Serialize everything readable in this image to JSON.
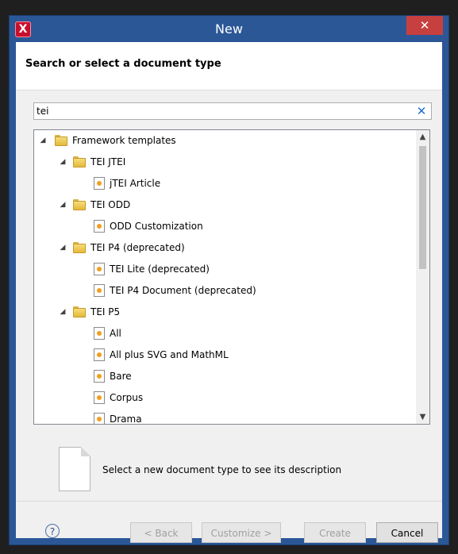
{
  "window": {
    "title": "New",
    "app_icon": "X",
    "close": "✕"
  },
  "header": {
    "title": "Search or select a document type"
  },
  "search": {
    "value": "tei",
    "clear": "✕"
  },
  "tree": {
    "items": [
      {
        "label": "Framework templates",
        "type": "folder",
        "expanded": true
      },
      {
        "label": "TEI JTEI",
        "type": "folder",
        "expanded": true
      },
      {
        "label": "jTEI Article",
        "type": "file"
      },
      {
        "label": "TEI ODD",
        "type": "folder",
        "expanded": true
      },
      {
        "label": "ODD Customization",
        "type": "file"
      },
      {
        "label": "TEI P4 (deprecated)",
        "type": "folder",
        "expanded": true
      },
      {
        "label": "TEI Lite (deprecated)",
        "type": "file"
      },
      {
        "label": "TEI P4 Document (deprecated)",
        "type": "file"
      },
      {
        "label": "TEI P5",
        "type": "folder",
        "expanded": true
      },
      {
        "label": "All",
        "type": "file"
      },
      {
        "label": "All plus SVG and MathML",
        "type": "file"
      },
      {
        "label": "Bare",
        "type": "file"
      },
      {
        "label": "Corpus",
        "type": "file"
      },
      {
        "label": "Drama",
        "type": "file"
      }
    ],
    "expander_glyph": "◢"
  },
  "description": {
    "text": "Select a new document type to see its description"
  },
  "footer": {
    "help": "?",
    "back": "< Back",
    "customize": "Customize >",
    "create": "Create",
    "cancel": "Cancel"
  },
  "colors": {
    "titlebar": "#2b5797",
    "close": "#c74040",
    "accent": "#1e6fd0"
  }
}
